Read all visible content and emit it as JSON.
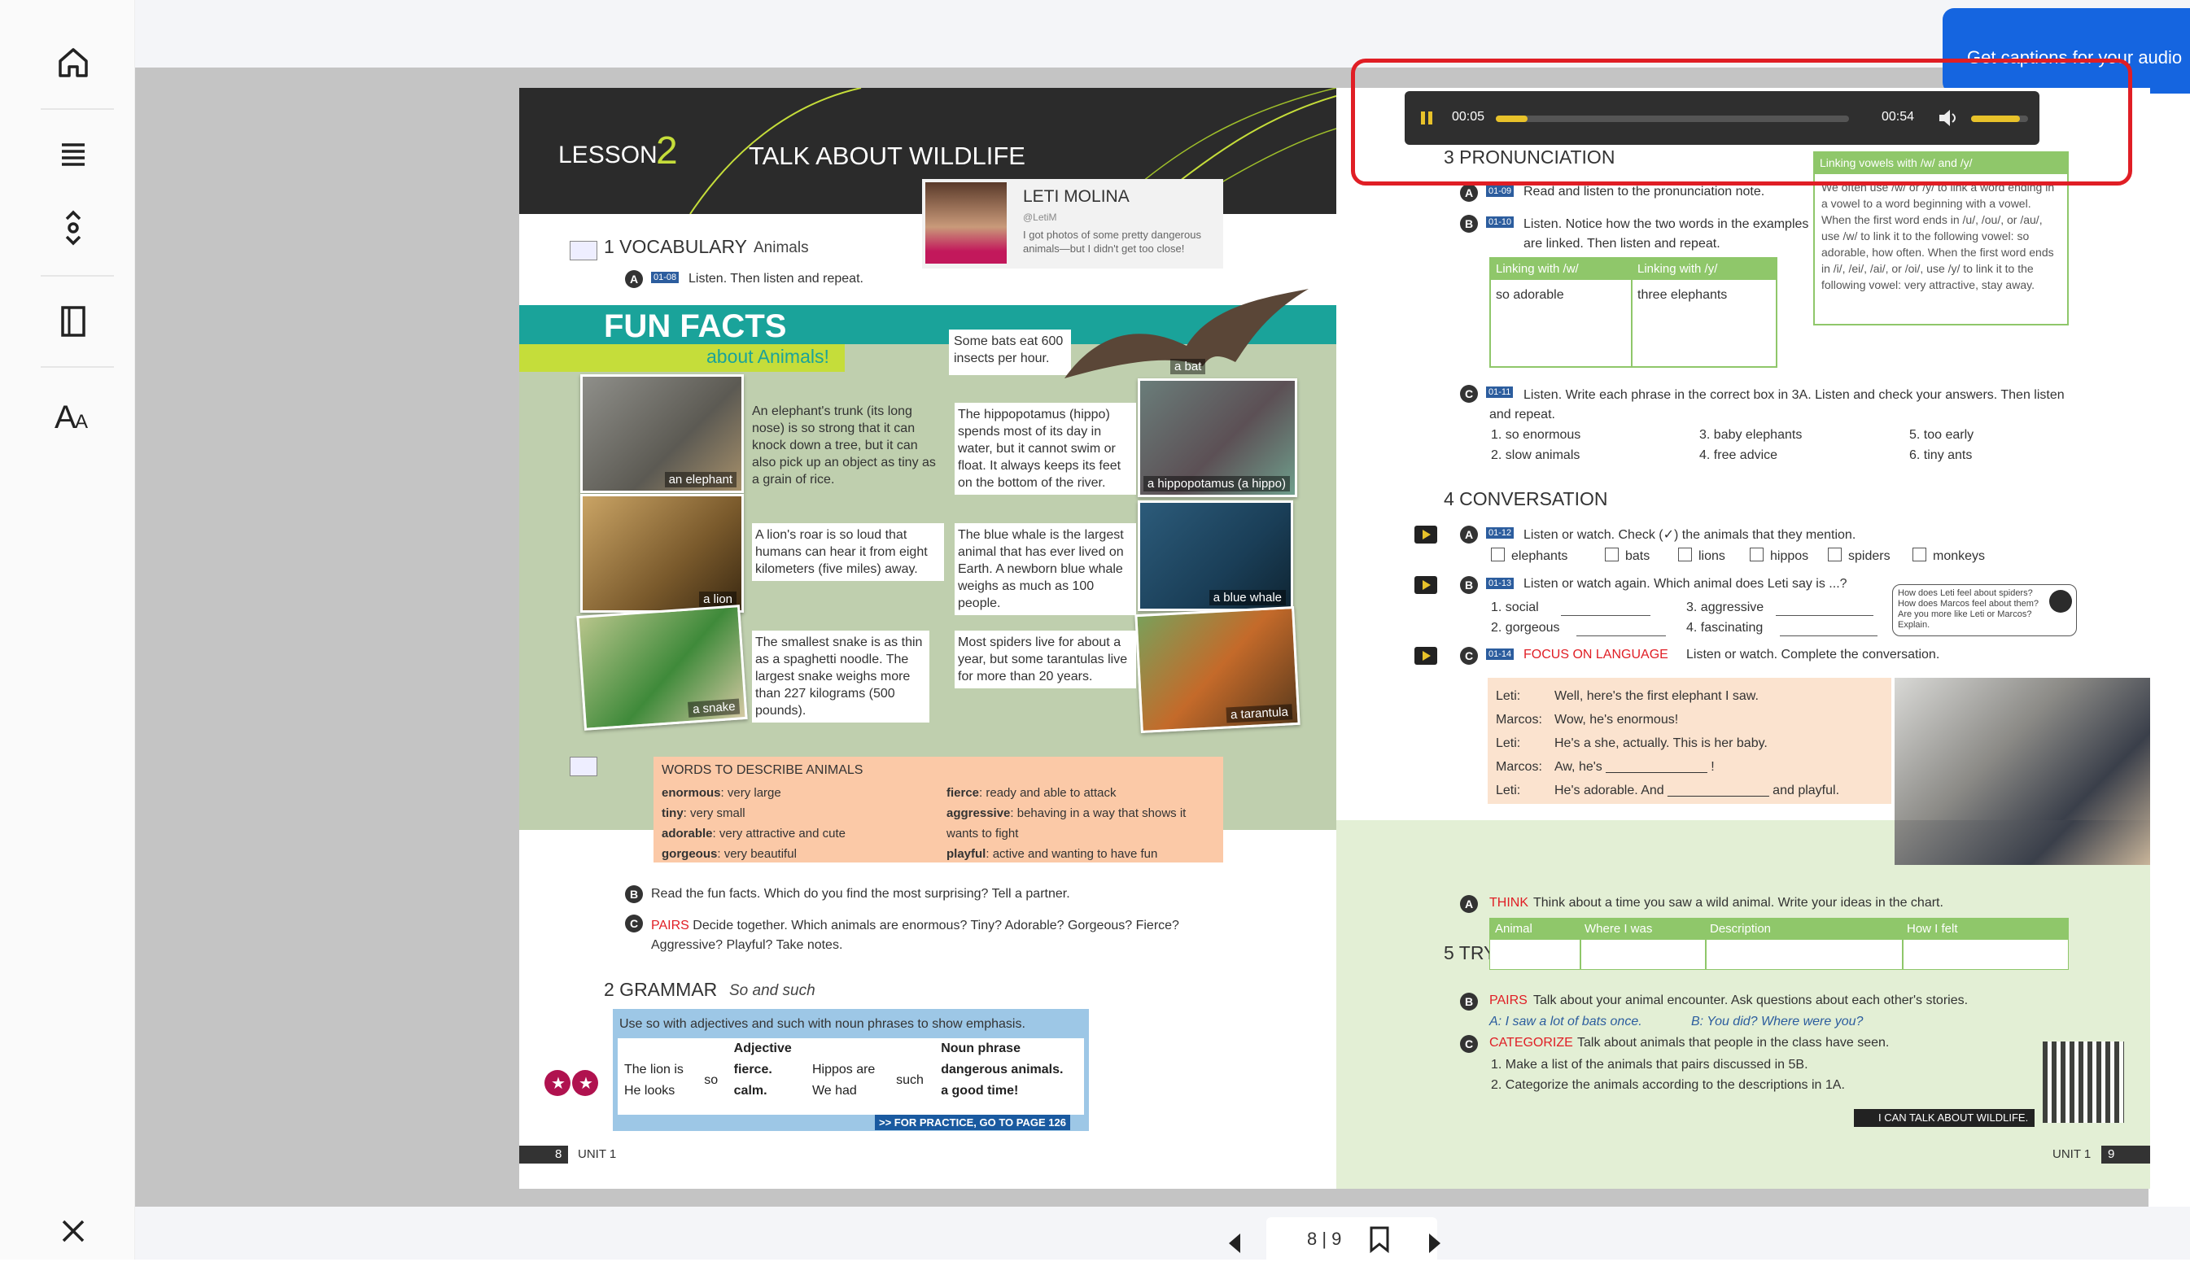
{
  "captions_banner": "Get captions for your audio",
  "audio": {
    "current": "00:05",
    "total": "00:54",
    "progress": 0.09,
    "volume": 0.85
  },
  "pager": {
    "label": "8 | 9"
  },
  "left_page": {
    "lesson": "LESSON",
    "lesson_num": "2",
    "lesson_title": "TALK ABOUT WILDLIFE",
    "profile_name": "LETI MOLINA",
    "profile_handle": "@LetiM",
    "profile_text": "I got photos of some pretty dangerous animals—but I didn't get too close!",
    "vocab_heading": "1  VOCABULARY",
    "vocab_sub": "Animals",
    "vocab_a_code": "01-08",
    "vocab_a": "Listen. Then listen and repeat.",
    "fun_facts": "FUN FACTS",
    "fun_facts_sub": "about Animals!",
    "bat_fact": "Some bats eat 600 insects per hour.",
    "bat_label": "a bat",
    "facts": [
      "An elephant's trunk (its long nose) is so strong that it can knock down a tree, but it can also pick up an object as tiny as a grain of rice.",
      "The hippopotamus (hippo) spends most of its day in water, but it cannot swim or float. It always keeps its feet on the bottom of the river.",
      "A lion's roar is so loud that humans can hear it from eight kilometers (five miles) away.",
      "The blue whale is the largest animal that has ever lived on Earth. A newborn blue whale weighs as much as 100 people.",
      "The smallest snake is as thin as a spaghetti noodle. The largest snake weighs more than 227 kilograms (500 pounds).",
      "Most spiders live for about a year, but some tarantulas live for more than 20 years."
    ],
    "photo_labels": [
      "an elephant",
      "a hippopotamus (a hippo)",
      "a lion",
      "a blue whale",
      "a snake",
      "a tarantula"
    ],
    "words_title": "WORDS TO DESCRIBE ANIMALS",
    "words_left": [
      [
        "enormous",
        "very large"
      ],
      [
        "tiny",
        "very small"
      ],
      [
        "adorable",
        "very attractive and cute"
      ],
      [
        "gorgeous",
        "very beautiful"
      ]
    ],
    "words_right": [
      [
        "fierce",
        "ready and able to attack"
      ],
      [
        "aggressive",
        "behaving in a way that shows it wants to fight"
      ],
      [
        "playful",
        "active and wanting to have fun"
      ]
    ],
    "b_text": "Read the fun facts. Which do you find the most surprising? Tell a partner.",
    "c_pairs": "PAIRS",
    "c_text": "Decide together. Which animals are enormous? Tiny? Adorable? Gorgeous? Fierce? Aggressive? Playful? Take notes.",
    "grammar_heading": "2  GRAMMAR",
    "grammar_sub": "So and such",
    "grammar_note": "Use so with adjectives and such with noun phrases to show emphasis.",
    "grammar_h1": "Adjective",
    "grammar_h2": "Noun phrase",
    "grammar_rows": [
      [
        "The lion is",
        "fierce.",
        "Hippos are",
        "dangerous animals."
      ],
      [
        "He looks",
        "calm.",
        "We had",
        "a good time!"
      ]
    ],
    "grammar_so": "so",
    "grammar_such": "such",
    "practice": ">> FOR PRACTICE, GO TO PAGE 126",
    "page_num": "8",
    "unit": "UNIT 1"
  },
  "right_page": {
    "pron_heading": "3  PRONUNCIATION",
    "pron_a_code": "01-09",
    "pron_a": "Read and listen to the pronunciation note.",
    "pron_b_code": "01-10",
    "pron_b": "Listen. Notice how the two words in the examples are linked. Then listen and repeat.",
    "link_w": "Linking with /w/",
    "link_y": "Linking with /y/",
    "ex_w": "so adorable",
    "ex_y": "three elephants",
    "note_title": "Linking vowels with /w/ and /y/",
    "note_text": "We often use /w/ or /y/ to link a word ending in a vowel to a word beginning with a vowel. When the first word ends in /u/, /ou/, or /au/, use /w/ to link it to the following vowel: so adorable, how often. When the first word ends in /i/, /ei/, /ai/, or /oi/, use /y/ to link it to the following vowel: very attractive, stay away.",
    "pron_c_code": "01-11",
    "pron_c": "Listen. Write each phrase in the correct box in 3A. Listen and check your answers. Then listen and repeat.",
    "phrases": [
      "1.  so enormous",
      "2.  slow animals",
      "3.  baby elephants",
      "4.  free advice",
      "5.  too early",
      "6.  tiny ants"
    ],
    "conv_heading": "4  CONVERSATION",
    "conv_a_code": "01-12",
    "conv_a": "Listen or watch. Check (✓) the animals that they mention.",
    "animals": [
      "elephants",
      "bats",
      "lions",
      "hippos",
      "spiders",
      "monkeys"
    ],
    "conv_b_code": "01-13",
    "conv_b": "Listen or watch again. Which animal does Leti say is ...?",
    "conv_b_items": [
      "1.  social",
      "2.  gorgeous",
      "3.  aggressive",
      "4.  fascinating"
    ],
    "conv_bubble": "How does Leti feel about spiders? How does Marcos feel about them? Are you more like Leti or Marcos? Explain.",
    "conv_c_code": "01-14",
    "conv_c_focus": "FOCUS ON LANGUAGE",
    "conv_c": "Listen or watch. Complete the conversation.",
    "dialogue": [
      [
        "Leti:",
        "Well, here's the first elephant I saw."
      ],
      [
        "Marcos:",
        "Wow, he's enormous!"
      ],
      [
        "Leti:",
        "He's a she, actually. This is her baby."
      ],
      [
        "Marcos:",
        "Aw, he's ______________ !"
      ],
      [
        "Leti:",
        "He's adorable. And ______________ and playful."
      ]
    ],
    "try_heading": "5  TRY IT YOURSELF",
    "try_a_think": "THINK",
    "try_a": "Think about a time you saw a wild animal. Write your ideas in the chart.",
    "chart_cols": [
      "Animal",
      "Where I was",
      "Description",
      "How I felt"
    ],
    "try_b_pairs": "PAIRS",
    "try_b": "Talk about your animal encounter. Ask questions about each other's stories.",
    "try_b_ex_a": "A:  I saw a lot of bats once.",
    "try_b_ex_b": "B:  You did? Where were you?",
    "try_c_cat": "CATEGORIZE",
    "try_c": "Talk about animals that people in the class have seen.",
    "try_c_items": [
      "1.  Make a list of the animals that pairs discussed in 5B.",
      "2.  Categorize the animals according to the descriptions in 1A."
    ],
    "can_do": "I CAN TALK ABOUT WILDLIFE.",
    "unit": "UNIT 1",
    "page_num": "9"
  },
  "colors": {
    "accent_blue": "#1565e0",
    "highlight_red": "#e01e25",
    "teal": "#1aa39a",
    "lime": "#c5dd3a",
    "peach": "#fbc9a7",
    "green_table": "#8fc76a"
  }
}
